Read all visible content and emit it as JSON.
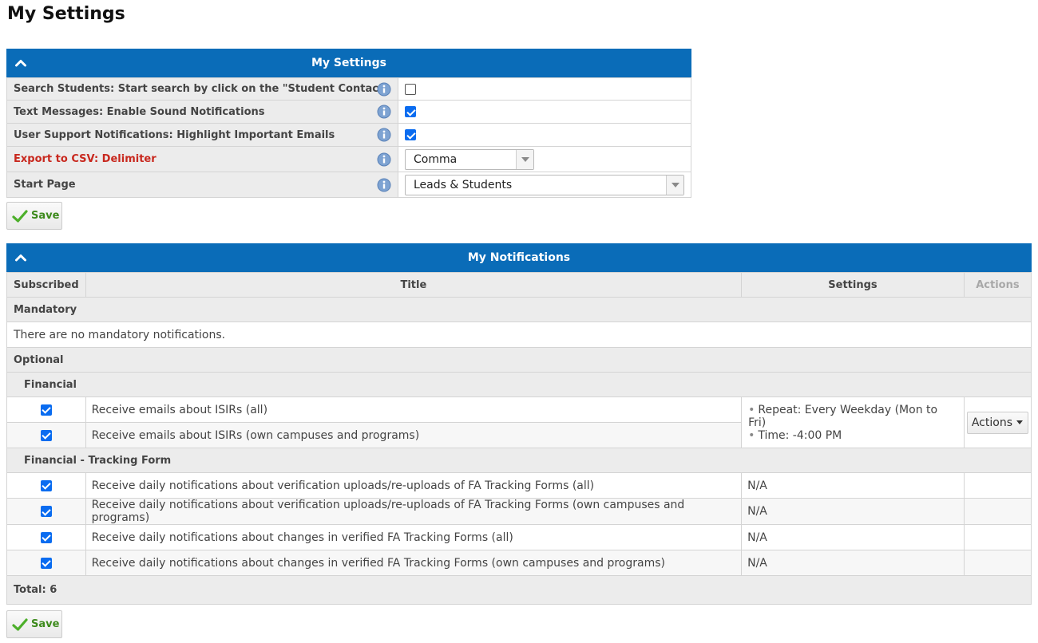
{
  "page": {
    "title": "My Settings"
  },
  "settings_panel": {
    "title": "My Settings",
    "rows": [
      {
        "label": "Search Students: Start search by click on the \"Student Contact\"",
        "type": "checkbox",
        "checked": false
      },
      {
        "label": "Text Messages: Enable Sound Notifications",
        "type": "checkbox",
        "checked": true
      },
      {
        "label": "User Support Notifications: Highlight Important Emails",
        "type": "checkbox",
        "checked": true
      },
      {
        "label": "Export to CSV: Delimiter",
        "type": "select",
        "value": "Comma",
        "label_color": "#c8281e"
      },
      {
        "label": "Start Page",
        "type": "select",
        "value": "Leads & Students"
      }
    ],
    "save_label": "Save"
  },
  "notifications_panel": {
    "title": "My Notifications",
    "columns": {
      "subscribed": "Subscribed",
      "title": "Title",
      "settings": "Settings",
      "actions": "Actions"
    },
    "mandatory": {
      "label": "Mandatory",
      "empty_text": "There are no mandatory notifications."
    },
    "optional": {
      "label": "Optional",
      "groups": [
        {
          "label": "Financial",
          "items": [
            {
              "title": "Receive emails about ISIRs (all)",
              "subscribed": true
            },
            {
              "title": "Receive emails about ISIRs (own campuses and programs)",
              "subscribed": true
            }
          ],
          "settings_lines": [
            "Repeat: Every Weekday (Mon to Fri)",
            "Time: -4:00 PM"
          ],
          "actions_label": "Actions"
        },
        {
          "label": "Financial - Tracking Form",
          "items": [
            {
              "title": "Receive daily notifications about verification uploads/re-uploads of FA Tracking Forms (all)",
              "subscribed": true,
              "settings": "N/A"
            },
            {
              "title": "Receive daily notifications about verification uploads/re-uploads of FA Tracking Forms (own campuses and programs)",
              "subscribed": true,
              "settings": "N/A"
            },
            {
              "title": "Receive daily notifications about changes in verified FA Tracking Forms (all)",
              "subscribed": true,
              "settings": "N/A"
            },
            {
              "title": "Receive daily notifications about changes in verified FA Tracking Forms (own campuses and programs)",
              "subscribed": true,
              "settings": "N/A"
            }
          ]
        }
      ]
    },
    "total_label": "Total: 6",
    "save_label": "Save"
  },
  "colors": {
    "header_blue": "#0a6cb8",
    "save_green": "#3d8a1c",
    "error_red": "#c8281e",
    "checkbox_blue": "#0a6cf0"
  },
  "icons": {
    "collapse": "chevron-up-icon",
    "info": "info-icon",
    "save": "check-icon",
    "dropdown": "caret-down-icon"
  }
}
